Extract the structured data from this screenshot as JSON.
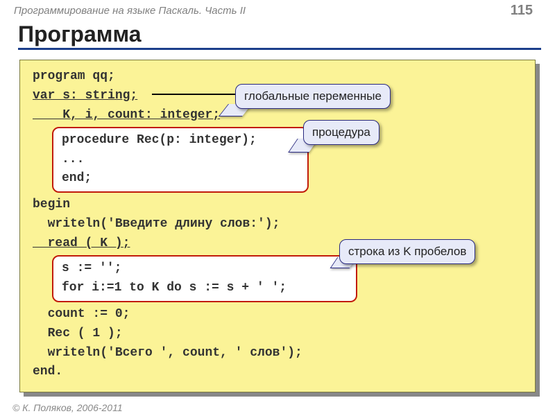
{
  "header": {
    "breadcrumb": "Программирование на языке Паскаль. Часть II",
    "page": "115"
  },
  "title": "Программа",
  "code": {
    "l1": "program qq;",
    "l2a": "var s: string;",
    "l3": "    K, i, count: integer;",
    "proc1": "procedure Rec(p: integer);",
    "proc2": "...",
    "proc3": "end;",
    "l5": "begin",
    "l6": "  writeln('Введите длину слов:');",
    "l7": "  read ( K );",
    "box2a": "s := '';",
    "box2b": "for i:=1 to K do s := s + ' ';",
    "l8": "  count := 0;",
    "l9": "  Rec ( 1 );",
    "l10": "  writeln('Всего ', count, ' слов');",
    "l11": "end."
  },
  "callouts": {
    "c1": "глобальные переменные",
    "c2": "процедура",
    "c3": "строка из K пробелов"
  },
  "footer": "© К. Поляков, 2006-2011"
}
